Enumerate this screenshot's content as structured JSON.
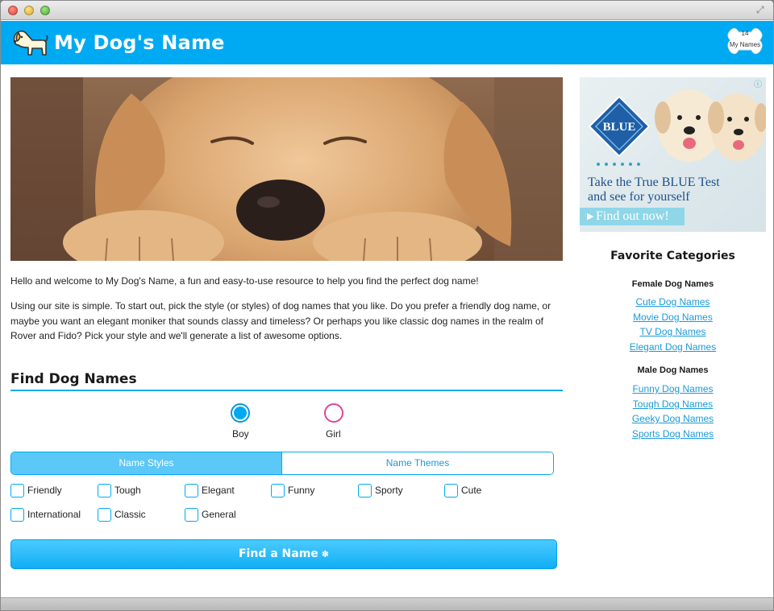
{
  "header": {
    "title": "My Dog's Name",
    "badge_count": "14",
    "badge_label": "My Names"
  },
  "ad": {
    "brand": "BLUE",
    "line1": "Take the True BLUE Test",
    "line2": "and see for yourself",
    "cta": "Find out now!"
  },
  "intro": {
    "welcome": "Hello and welcome to My Dog's Name, a fun and easy-to-use resource to help you find the perfect dog name!",
    "instructions": "Using our site is simple. To start out, pick the style (or styles) of dog names that you like. Do you prefer a friendly dog name, or maybe you want an elegant moniker that sounds classy and timeless? Or perhaps you like classic dog names in the realm of Rover and Fido? Pick your style and we'll generate a list of awesome options."
  },
  "finder": {
    "title": "Find Dog Names",
    "gender": {
      "boy": "Boy",
      "girl": "Girl",
      "selected": "Boy"
    },
    "tabs": [
      "Name Styles",
      "Name Themes"
    ],
    "active_tab": "Name Styles",
    "styles": [
      "Friendly",
      "Tough",
      "Elegant",
      "Funny",
      "Sporty",
      "Cute",
      "International",
      "Classic",
      "General"
    ],
    "button_label": "Find a Name"
  },
  "sidebar": {
    "title": "Favorite Categories",
    "female_heading": "Female Dog Names",
    "female_links": [
      "Cute Dog Names",
      "Movie Dog Names",
      "TV Dog Names",
      "Elegant Dog Names"
    ],
    "male_heading": "Male Dog Names",
    "male_links": [
      "Funny Dog Names",
      "Tough Dog Names",
      "Geeky Dog Names",
      "Sports Dog Names"
    ]
  },
  "colors": {
    "brand_blue": "#00aaf2",
    "girl_pink": "#e0449a",
    "link_blue": "#1a9ad8"
  }
}
